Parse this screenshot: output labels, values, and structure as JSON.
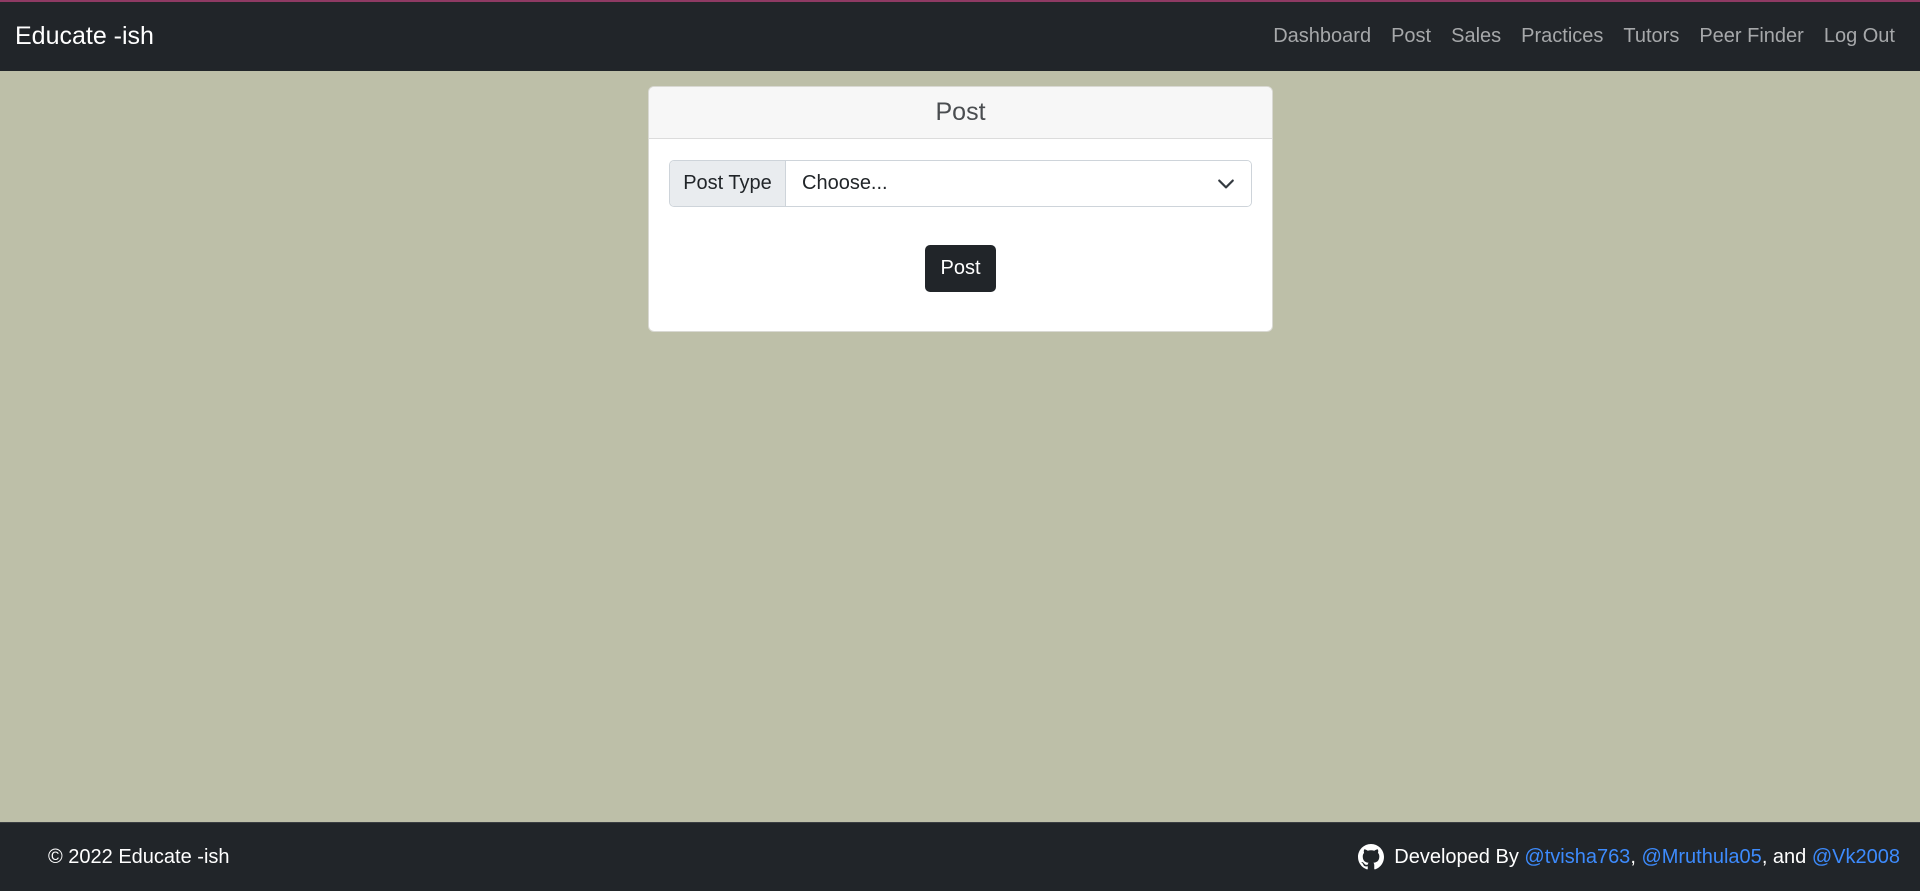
{
  "navbar": {
    "brand": "Educate -ish",
    "links": [
      "Dashboard",
      "Post",
      "Sales",
      "Practices",
      "Tutors",
      "Peer Finder",
      "Log Out"
    ]
  },
  "card": {
    "title": "Post",
    "field_label": "Post Type",
    "select_value": "Choose...",
    "submit_label": "Post"
  },
  "footer": {
    "copyright": "© 2022 Educate -ish",
    "developed_by": "Developed By",
    "devs": [
      "@tvisha763",
      "@Mruthula05",
      "@Vk2008"
    ],
    "sep1": ", ",
    "sep2": ", and "
  },
  "colors": {
    "background": "#bdbfa8",
    "navbar": "#212529",
    "link": "#3d8bfd"
  },
  "icons": [
    "chevron-down-icon",
    "github-icon"
  ]
}
